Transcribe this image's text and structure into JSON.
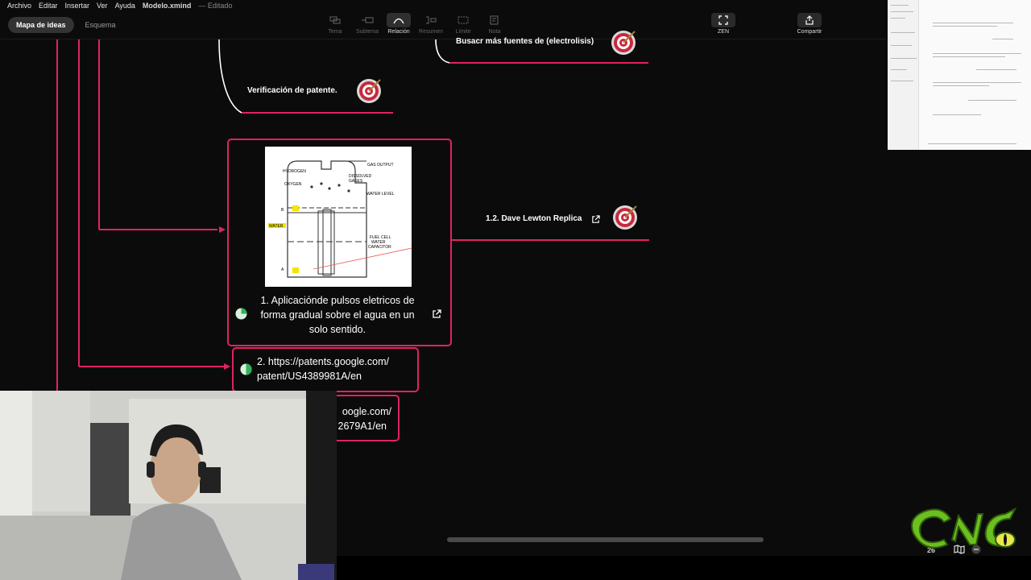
{
  "menubar": {
    "items": [
      "Archivo",
      "Editar",
      "Insertar",
      "Ver",
      "Ayuda"
    ],
    "file_name": "Modelo.xmind",
    "file_state": "— Editado"
  },
  "view_switch": {
    "mind_map": "Mapa de ideas",
    "outline": "Esquema"
  },
  "toolbar": {
    "topic": "Tema",
    "subtopic": "Subtema",
    "relationship": "Relación",
    "summary": "Resumen",
    "boundary": "Límite",
    "note": "Nota",
    "zen": "ZEN",
    "share": "Compartir"
  },
  "nodes": {
    "search_sources": "Busacr más fuentes de (electrolisis)",
    "patent_check": "Verificación de patente.",
    "dave_lewton": "1.2. Dave Lewton Replica",
    "main_caption": "1. Aplicaciónde pulsos eletricos de forma gradual sobre el agua en un solo sentido.",
    "link_2": "2. https://patents.google.com/patent/US4389981A/en",
    "link_2_line1": "2. https://patents.google.com/",
    "link_2_line2": "patent/US4389981A/en",
    "link_3_line1": "oogle.com/",
    "link_3_line2": "2679A1/en"
  },
  "diagram_labels": {
    "gas_output": "GAS OUTPUT",
    "hydrogen": "HYDROGEN",
    "dissolved_1": "DISSOLVED",
    "dissolved_2": "GASES",
    "oxygen": "OXYGEN",
    "water_level": "WATER LEVEL",
    "b": "B",
    "water": "WATER",
    "fuel_cell_1": "FUEL CELL",
    "fuel_cell_2": "WATER",
    "fuel_cell_3": "CAPACITOR",
    "a": "A"
  },
  "status": {
    "zoom": "26"
  },
  "colors": {
    "accent": "#e0245e",
    "background": "#0b0b0c",
    "target_red": "#c8283c",
    "progress_green": "#2fb45a",
    "logo_green": "#6bbf1e"
  },
  "icons": [
    "target-icon",
    "external-link-icon",
    "progress-pie-icon",
    "zen-fullscreen-icon",
    "share-icon",
    "map-icon",
    "minus-icon"
  ],
  "progress": {
    "main_topic": 0.25,
    "link_2": 0.5
  }
}
